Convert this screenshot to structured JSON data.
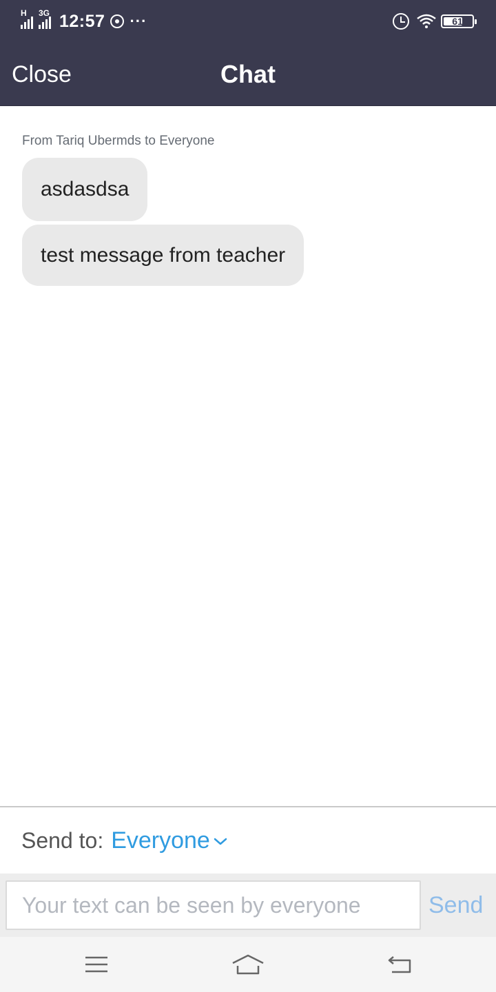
{
  "status_bar": {
    "time": "12:57",
    "network_1": "H",
    "network_2": "3G",
    "battery_level": "61",
    "icons": [
      "signal-icon",
      "whatsapp-icon",
      "more-dots-icon",
      "alarm-icon",
      "wifi-icon",
      "battery-icon"
    ]
  },
  "header": {
    "close_label": "Close",
    "title": "Chat",
    "background": "#3a3a4f"
  },
  "messages": {
    "sender_line": "From Tariq Ubermds to Everyone",
    "items": [
      {
        "text": "asdasdsa"
      },
      {
        "text": "test message from teacher"
      }
    ]
  },
  "composer": {
    "send_to_label": "Send to:",
    "send_to_value": "Everyone",
    "input_value": "",
    "input_placeholder": "Your text can be seen by everyone",
    "send_label": "Send",
    "accent": "#2f9be0"
  },
  "nav_bar": {
    "icons": [
      "menu-icon",
      "home-icon",
      "back-icon"
    ]
  }
}
